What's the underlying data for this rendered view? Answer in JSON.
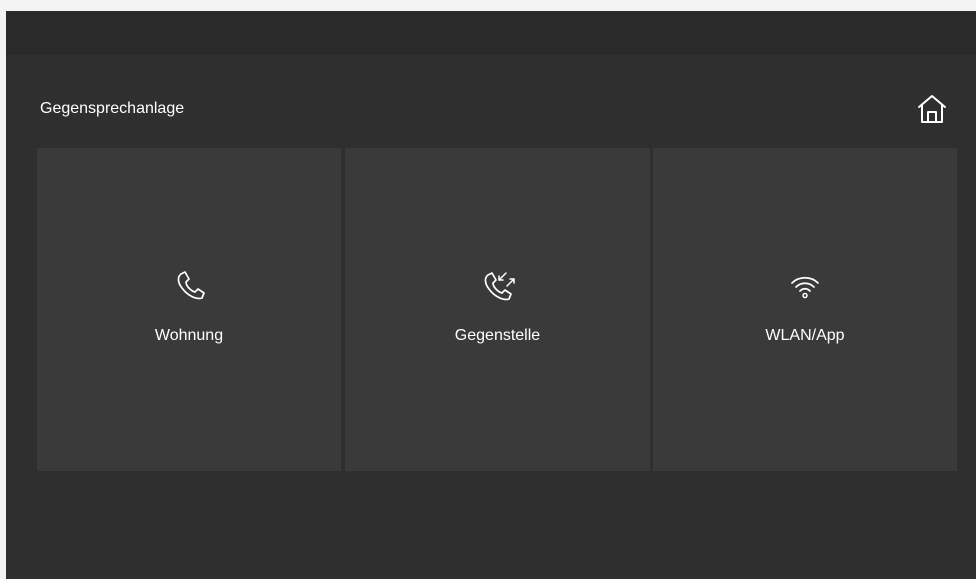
{
  "header": {
    "title": "Gegensprechanlage",
    "home_icon": "home-icon"
  },
  "tiles": [
    {
      "label": "Wohnung",
      "icon": "phone-icon"
    },
    {
      "label": "Gegenstelle",
      "icon": "phone-transfer-icon"
    },
    {
      "label": "WLAN/App",
      "icon": "wifi-icon"
    }
  ],
  "colors": {
    "background": "#2f2f30",
    "top_bar": "#2a2a2b",
    "tile": "#3a3a3b",
    "text": "#ffffff",
    "outer_frame": "#f3f3f3"
  }
}
